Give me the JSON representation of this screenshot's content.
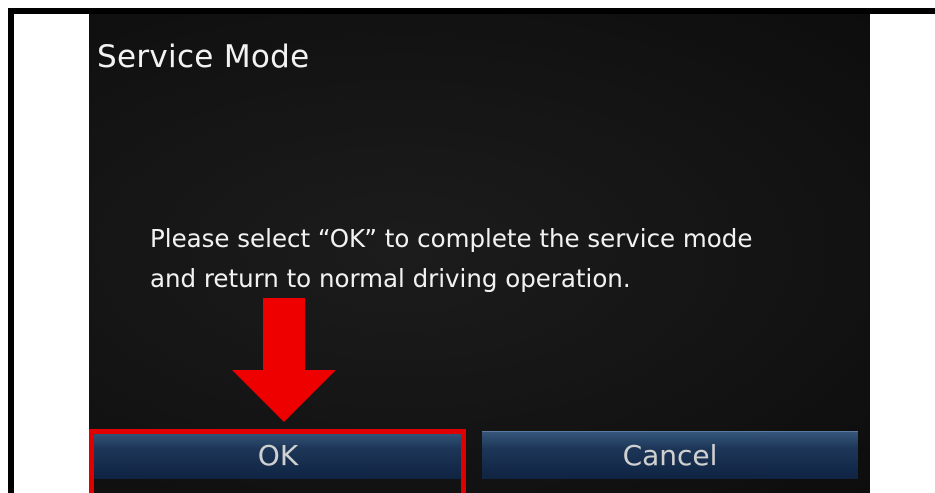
{
  "screen": {
    "title": "Service Mode",
    "message_line1": "Please select “OK” to complete the service mode",
    "message_line2": "and return to normal driving operation."
  },
  "buttons": {
    "ok_label": "OK",
    "cancel_label": "Cancel"
  },
  "annotation": {
    "highlight_color": "#e00000",
    "arrow_icon": "arrow-down-icon"
  },
  "colors": {
    "screen_bg": "#141414",
    "button_blue": "#1d3658",
    "text": "#f2f2f2"
  }
}
